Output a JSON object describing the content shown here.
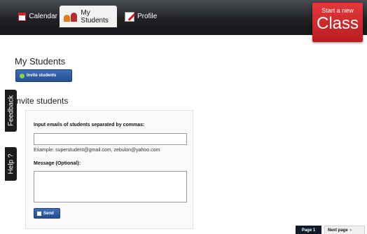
{
  "nav": {
    "tabs": [
      {
        "label": "Calendar",
        "icon": "calendar-icon"
      },
      {
        "label": "My Students",
        "icon": "students-icon"
      },
      {
        "label": "Profile",
        "icon": "pencil-icon"
      }
    ],
    "start_class": {
      "line1": "Start a new",
      "line2": "Class"
    }
  },
  "side": {
    "feedback": "Feedback",
    "help": "Help ?"
  },
  "main": {
    "title": "My Students",
    "invite_button": "Invite students",
    "section_title": "Invite students",
    "form": {
      "emails_label": "Input emails of students separated by commas:",
      "emails_value": "",
      "example": "Example: superstudent@gmail.com, zebulon@yahoo.com",
      "message_label": "Message (Optional):",
      "message_value": "",
      "send": "Send"
    }
  },
  "pagination": {
    "current": "Page 1",
    "next": "Next page"
  },
  "colors": {
    "accent_blue": "#2f5ea6",
    "brand_red": "#d12b2e",
    "nav_dark": "#1f2125"
  }
}
